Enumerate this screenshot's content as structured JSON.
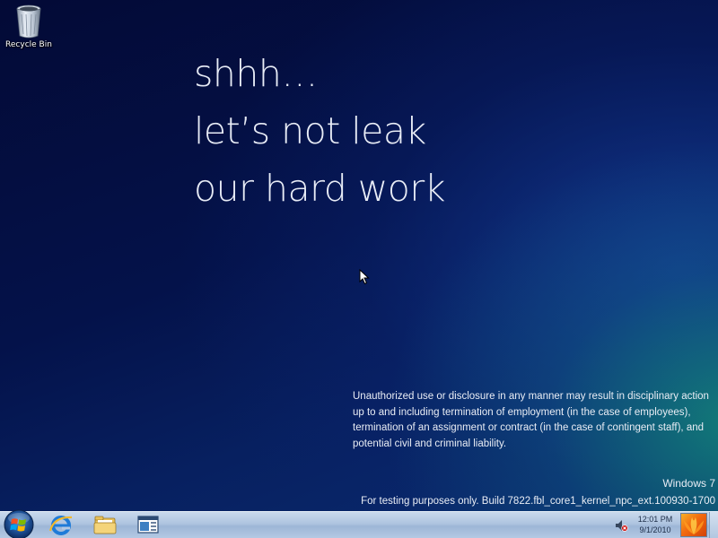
{
  "desktop": {
    "icons": [
      {
        "label": "Recycle Bin",
        "icon": "recycle-bin-icon"
      }
    ],
    "headline": [
      "shhh…",
      "let’s not leak",
      "our hard work"
    ],
    "disclaimer": "Unauthorized use or disclosure in any manner may result in disciplinary action up to and including termination of employment (in the case of employees), termination of an assignment or contract (in the case of contingent staff), and potential civil and criminal liability.",
    "watermark": {
      "os_name": "Windows 7",
      "build": "For testing purposes only. Build 7822.fbl_core1_kernel_npc_ext.100930-1700"
    }
  },
  "taskbar": {
    "start_icon": "windows-orb-icon",
    "pinned": [
      {
        "icon": "internet-explorer-icon"
      },
      {
        "icon": "file-explorer-icon"
      },
      {
        "icon": "app-window-icon"
      }
    ],
    "tray": {
      "volume_icon": "volume-muted-icon",
      "time": "12:01 PM",
      "date": "9/1/2010"
    }
  },
  "colors": {
    "accent_text": "#e9edf5",
    "taskbar": "#b4c9e3"
  }
}
